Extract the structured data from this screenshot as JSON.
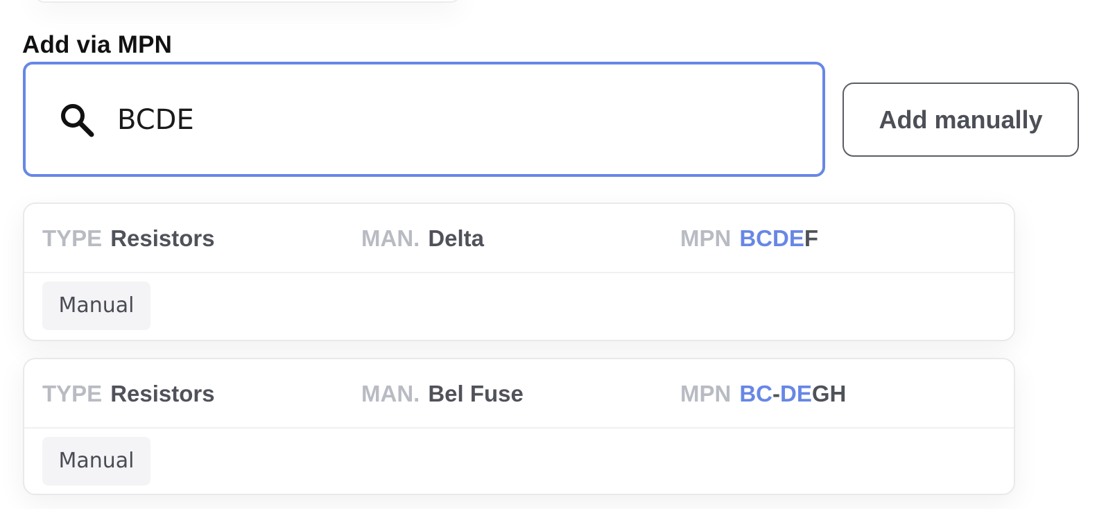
{
  "section": {
    "title": "Add via MPN"
  },
  "search": {
    "value": "BCDE",
    "icon": "search-icon"
  },
  "actions": {
    "add_manually_label": "Add manually"
  },
  "results": [
    {
      "type_key": "TYPE",
      "type_value": "Resistors",
      "man_key": "MAN.",
      "man_value": "Delta",
      "mpn_key": "MPN",
      "mpn_match": "BCDE",
      "mpn_rest": "F",
      "badge": "Manual"
    },
    {
      "type_key": "TYPE",
      "type_value": "Resistors",
      "man_key": "MAN.",
      "man_value": "Bel Fuse",
      "mpn_key": "MPN",
      "mpn_match_1": "BC",
      "mpn_sep": "-",
      "mpn_match_2": "DE",
      "mpn_rest": "GH",
      "badge": "Manual"
    }
  ],
  "colors": {
    "accent": "#6787e6",
    "muted_key": "#b9bbc3",
    "value_text": "#50525a"
  }
}
